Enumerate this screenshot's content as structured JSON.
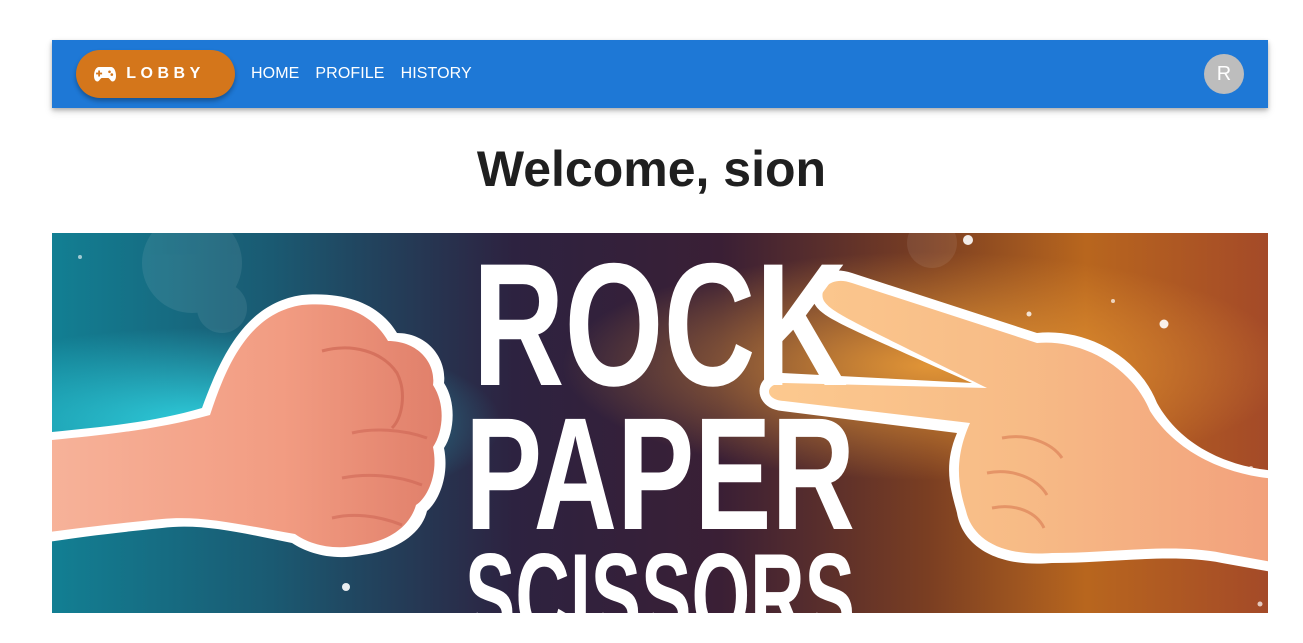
{
  "appbar": {
    "lobby_label": "LOBBY",
    "lobby_icon": "gamepad-icon",
    "nav": [
      "HOME",
      "PROFILE",
      "HISTORY"
    ],
    "avatar_initial": "R",
    "brand_color": "#1e78d6",
    "accent_color": "#d4761b"
  },
  "main": {
    "welcome": "Welcome, sion"
  },
  "banner": {
    "line1": "ROCK",
    "line2": "PAPER",
    "line3": "SCISSORS",
    "left_image": "fist-icon",
    "right_image": "victory-hand-icon"
  }
}
